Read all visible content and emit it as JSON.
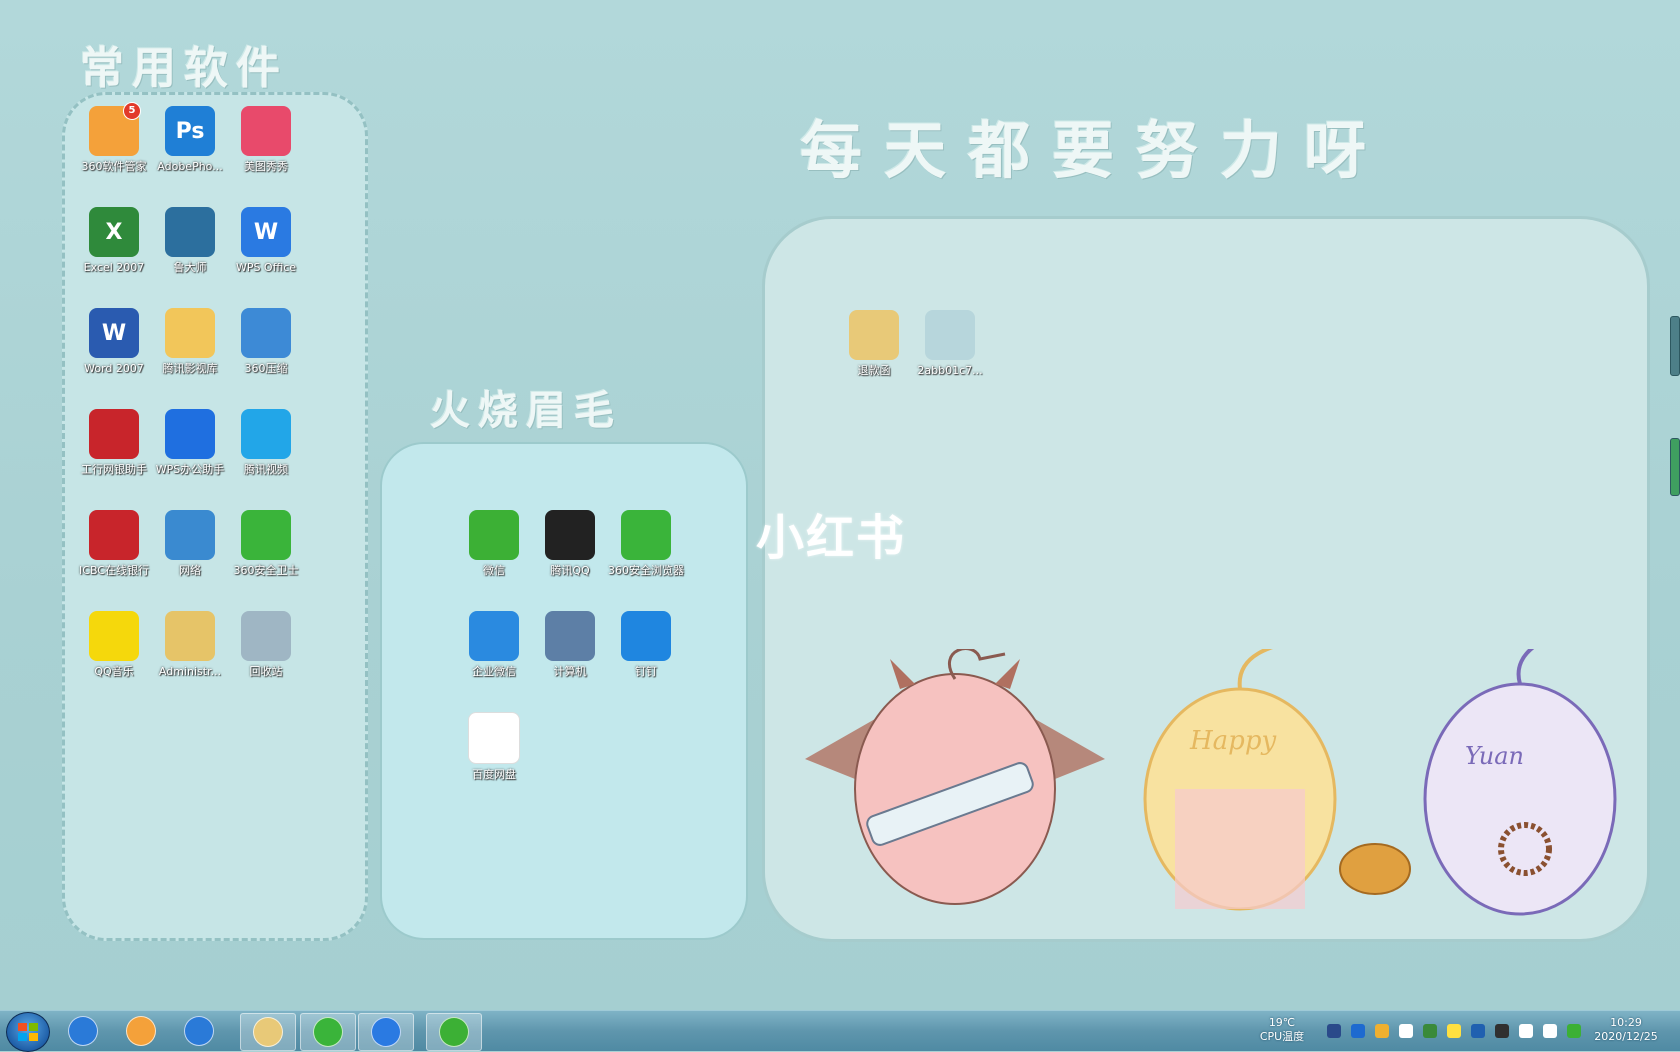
{
  "fences": {
    "left_title": "常用软件",
    "middle_title": "火烧眉毛",
    "right_title": "每天都要努力呀"
  },
  "left_icons": [
    {
      "label": "360软件管家",
      "icon": "360-software-manager-icon",
      "color": "#f4a13a",
      "badge": "5"
    },
    {
      "label": "AdobePho...",
      "icon": "photoshop-icon",
      "color": "#1f7fd6",
      "glyph": "Ps"
    },
    {
      "label": "美图秀秀",
      "icon": "meitu-icon",
      "color": "#e84a6b"
    },
    {
      "label": "Excel 2007",
      "icon": "excel-icon",
      "color": "#2f8a3b",
      "glyph": "X"
    },
    {
      "label": "鲁大师",
      "icon": "ludashi-icon",
      "color": "#2c6f9e"
    },
    {
      "label": "WPS Office",
      "icon": "wps-office-icon",
      "color": "#2a7ae2",
      "glyph": "W"
    },
    {
      "label": "Word 2007",
      "icon": "word-icon",
      "color": "#2a5bb0",
      "glyph": "W"
    },
    {
      "label": "腾讯影视库",
      "icon": "tencent-video-library-icon",
      "color": "#f2c65a"
    },
    {
      "label": "360压缩",
      "icon": "360-zip-icon",
      "color": "#3d8ad6"
    },
    {
      "label": "工行网银助手",
      "icon": "icbc-assistant-icon",
      "color": "#c8252b"
    },
    {
      "label": "WPS办公助手",
      "icon": "wps-assistant-icon",
      "color": "#1f6fe0"
    },
    {
      "label": "腾讯视频",
      "icon": "tencent-video-icon",
      "color": "#22a6e8"
    },
    {
      "label": "ICBC在线银行",
      "icon": "icbc-online-icon",
      "color": "#c8252b"
    },
    {
      "label": "网络",
      "icon": "network-icon",
      "color": "#3a8ad0"
    },
    {
      "label": "360安全卫士",
      "icon": "360-security-icon",
      "color": "#3ab43a"
    },
    {
      "label": "QQ音乐",
      "icon": "qq-music-icon",
      "color": "#f5d80c"
    },
    {
      "label": "Administr...",
      "icon": "user-folder-icon",
      "color": "#e6c468"
    },
    {
      "label": "回收站",
      "icon": "recycle-bin-icon",
      "color": "#9fb6c4"
    }
  ],
  "middle_icons": [
    {
      "label": "微信",
      "icon": "wechat-icon",
      "color": "#3cb035"
    },
    {
      "label": "腾讯QQ",
      "icon": "qq-icon",
      "color": "#222222"
    },
    {
      "label": "360安全浏览器",
      "icon": "360-browser-icon",
      "color": "#3ab43a"
    },
    {
      "label": "企业微信",
      "icon": "wecom-icon",
      "color": "#2a8ae0"
    },
    {
      "label": "计算机",
      "icon": "computer-icon",
      "color": "#5d7fa6"
    },
    {
      "label": "钉钉",
      "icon": "dingtalk-icon",
      "color": "#1f86e0"
    },
    {
      "label": "百度网盘",
      "icon": "baidu-netdisk-icon",
      "color": "#ffffff"
    }
  ],
  "right_icons": [
    {
      "label": "退款函",
      "icon": "folder-icon",
      "color": "#e8c978"
    },
    {
      "label": "2abb01c7...",
      "icon": "image-file-icon",
      "color": "#b7d6dc"
    }
  ],
  "watermark": "小红书",
  "taskbar": {
    "pinned": [
      {
        "name": "ie-taskbar-icon",
        "color": "#2a7ad8"
      },
      {
        "name": "360-software-taskbar-icon",
        "color": "#f4a13a"
      },
      {
        "name": "ie-alt-taskbar-icon",
        "color": "#2a7ad8"
      },
      {
        "name": "explorer-taskbar-icon",
        "color": "#e8c978"
      },
      {
        "name": "360-browser-taskbar-icon",
        "color": "#3ab43a"
      },
      {
        "name": "wps-taskbar-icon",
        "color": "#2a7ae2"
      },
      {
        "name": "wechat-taskbar-icon",
        "color": "#3cb035"
      }
    ],
    "temp_value": "19℃",
    "temp_label": "CPU温度",
    "time": "10:29",
    "date": "2020/12/25"
  }
}
